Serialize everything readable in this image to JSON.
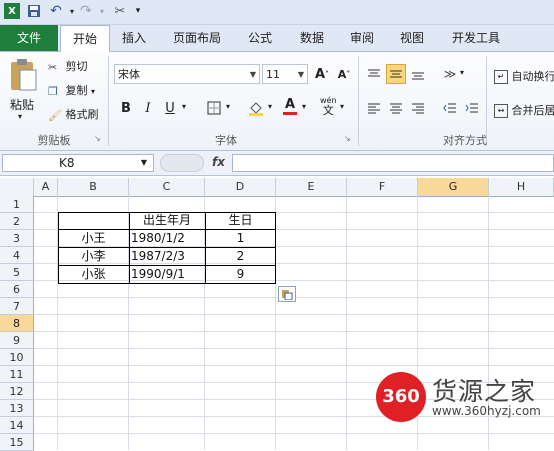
{
  "qat": {
    "excel_icon": "excel-icon",
    "save_icon": "save-icon",
    "undo_icon": "undo-icon",
    "redo_icon": "redo-icon",
    "customize_icon": "customize-icon"
  },
  "tabs": [
    "文件",
    "开始",
    "插入",
    "页面布局",
    "公式",
    "数据",
    "审阅",
    "视图",
    "开发工具"
  ],
  "ribbon": {
    "paste_label": "粘贴",
    "cut_label": "剪切",
    "copy_label": "复制",
    "format_painter_label": "格式刷",
    "clipboard_group": "剪贴板",
    "font_name": "宋体",
    "font_size": "11",
    "font_group": "字体",
    "bold": "B",
    "italic": "I",
    "underline": "U",
    "grow_font": "A",
    "shrink_font": "A",
    "wen": "wén",
    "wen_char": "文",
    "align_group": "对齐方式",
    "wrap_text_label": "自动换行",
    "merge_label": "合并后居"
  },
  "formula_bar": {
    "name_box": "K8",
    "fx": "fx",
    "value": ""
  },
  "columns": [
    "A",
    "B",
    "C",
    "D",
    "E",
    "F",
    "G",
    "H"
  ],
  "rows": [
    "1",
    "2",
    "3",
    "4",
    "5",
    "6",
    "7",
    "8",
    "9",
    "10",
    "11",
    "12",
    "13",
    "14",
    "15"
  ],
  "selection": {
    "column": "G",
    "row": "8"
  },
  "table": {
    "header": [
      "",
      "出生年月",
      "生日"
    ],
    "rows": [
      [
        "小王",
        "1980/1/2",
        "1"
      ],
      [
        "小李",
        "1987/2/3",
        "2"
      ],
      [
        "小张",
        "1990/9/1",
        "9"
      ]
    ]
  },
  "watermark": {
    "logo": "360",
    "name": "货源之家",
    "url": "www.360hyzj.com"
  },
  "colors": {
    "file_tab": "#1f7e3b",
    "selection_header": "#f9d99a",
    "watermark_red": "#e11f26"
  }
}
